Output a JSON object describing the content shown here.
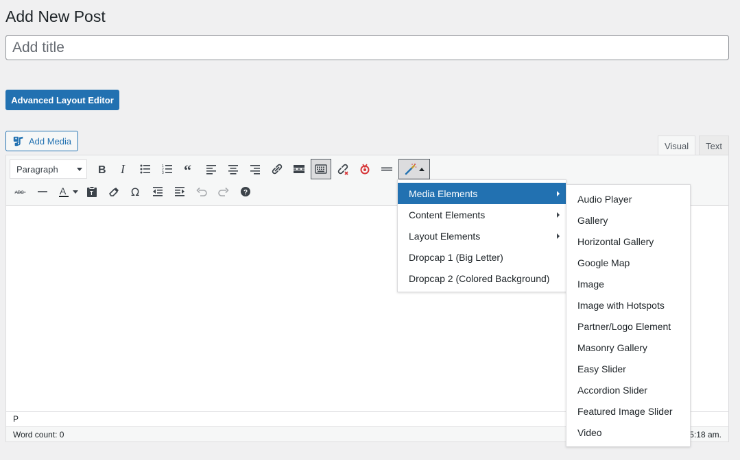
{
  "page": {
    "title": "Add New Post"
  },
  "title_input": {
    "placeholder": "Add title"
  },
  "buttons": {
    "advanced_layout_editor": "Advanced Layout Editor",
    "add_media": "Add Media"
  },
  "tabs": [
    {
      "label": "Visual",
      "active": true
    },
    {
      "label": "Text",
      "active": false
    }
  ],
  "toolbar": {
    "format_select": "Paragraph",
    "row1_icons": [
      "bold-icon",
      "italic-icon",
      "bullet-list-icon",
      "numbered-list-icon",
      "blockquote-icon",
      "align-left-icon",
      "align-center-icon",
      "align-right-icon",
      "link-icon",
      "read-more-icon",
      "toolbar-toggle-icon",
      "unlink-icon",
      "spellcheck-icon",
      "horizontal-line-icon",
      "magic-wand-icon"
    ],
    "row2_icons": [
      "strikethrough-icon",
      "horizontal-rule-icon",
      "text-color-icon",
      "paste-as-text-icon",
      "clear-formatting-icon",
      "special-character-icon",
      "outdent-icon",
      "indent-icon",
      "undo-icon",
      "redo-icon",
      "help-icon"
    ]
  },
  "editor": {
    "path": "P",
    "word_count": "Word count: 0",
    "last_edited": "5:18 am."
  },
  "shortcode_menu": {
    "items": [
      {
        "label": "Media Elements",
        "has_submenu": true,
        "active": true
      },
      {
        "label": "Content Elements",
        "has_submenu": true,
        "active": false
      },
      {
        "label": "Layout Elements",
        "has_submenu": true,
        "active": false
      },
      {
        "label": "Dropcap 1 (Big Letter)",
        "has_submenu": false,
        "active": false
      },
      {
        "label": "Dropcap 2 (Colored Background)",
        "has_submenu": false,
        "active": false
      }
    ],
    "submenu": [
      "Audio Player",
      "Gallery",
      "Horizontal Gallery",
      "Google Map",
      "Image",
      "Image with Hotspots",
      "Partner/Logo Element",
      "Masonry Gallery",
      "Easy Slider",
      "Accordion Slider",
      "Featured Image Slider",
      "Video"
    ]
  },
  "colors": {
    "primary": "#2271b1",
    "background": "#f0f0f1",
    "text": "#1d2327",
    "spellcheck_accent": "#d63638"
  }
}
